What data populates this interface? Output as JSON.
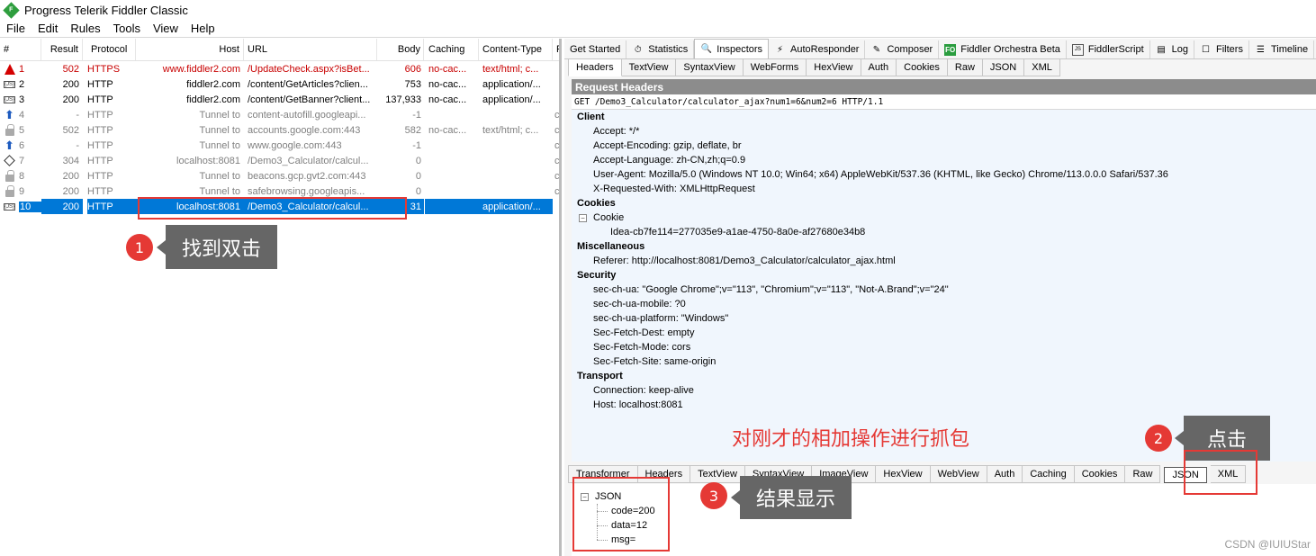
{
  "app": {
    "title": "Progress Telerik Fiddler Classic",
    "icon_letter": "F"
  },
  "menu": [
    "File",
    "Edit",
    "Rules",
    "Tools",
    "View",
    "Help"
  ],
  "sessions": {
    "columns": {
      "num": "#",
      "result": "Result",
      "protocol": "Protocol",
      "host": "Host",
      "url": "URL",
      "body": "Body",
      "caching": "Caching",
      "content_type": "Content-Type",
      "p": "P"
    },
    "rows": [
      {
        "icon": "warning-icon",
        "num": "1",
        "result": "502",
        "protocol": "HTTPS",
        "host": "www.fiddler2.com",
        "url": "/UpdateCheck.aspx?isBet...",
        "body": "606",
        "caching": "no-cac...",
        "content_type": "text/html; c...",
        "p": "",
        "style": "red"
      },
      {
        "icon": "json-icon",
        "num": "2",
        "result": "200",
        "protocol": "HTTP",
        "host": "fiddler2.com",
        "url": "/content/GetArticles?clien...",
        "body": "753",
        "caching": "no-cac...",
        "content_type": "application/...",
        "p": "",
        "style": "normal"
      },
      {
        "icon": "json-icon",
        "num": "3",
        "result": "200",
        "protocol": "HTTP",
        "host": "fiddler2.com",
        "url": "/content/GetBanner?client...",
        "body": "137,933",
        "caching": "no-cac...",
        "content_type": "application/...",
        "p": "",
        "style": "normal"
      },
      {
        "icon": "upload-arrow-icon",
        "num": "4",
        "result": "-",
        "protocol": "HTTP",
        "host": "Tunnel to",
        "url": "content-autofill.googleapi...",
        "body": "-1",
        "caching": "",
        "content_type": "",
        "p": "c",
        "style": "gray"
      },
      {
        "icon": "lock-icon",
        "num": "5",
        "result": "502",
        "protocol": "HTTP",
        "host": "Tunnel to",
        "url": "accounts.google.com:443",
        "body": "582",
        "caching": "no-cac...",
        "content_type": "text/html; c...",
        "p": "c",
        "style": "gray"
      },
      {
        "icon": "upload-arrow-icon",
        "num": "6",
        "result": "-",
        "protocol": "HTTP",
        "host": "Tunnel to",
        "url": "www.google.com:443",
        "body": "-1",
        "caching": "",
        "content_type": "",
        "p": "c",
        "style": "gray"
      },
      {
        "icon": "diamond-icon",
        "num": "7",
        "result": "304",
        "protocol": "HTTP",
        "host": "localhost:8081",
        "url": "/Demo3_Calculator/calcul...",
        "body": "0",
        "caching": "",
        "content_type": "",
        "p": "c",
        "style": "gray"
      },
      {
        "icon": "lock-icon",
        "num": "8",
        "result": "200",
        "protocol": "HTTP",
        "host": "Tunnel to",
        "url": "beacons.gcp.gvt2.com:443",
        "body": "0",
        "caching": "",
        "content_type": "",
        "p": "c",
        "style": "gray"
      },
      {
        "icon": "lock-icon",
        "num": "9",
        "result": "200",
        "protocol": "HTTP",
        "host": "Tunnel to",
        "url": "safebrowsing.googleapis...",
        "body": "0",
        "caching": "",
        "content_type": "",
        "p": "c",
        "style": "gray"
      },
      {
        "icon": "json-icon",
        "num": "10",
        "result": "200",
        "protocol": "HTTP",
        "host": "localhost:8081",
        "url": "/Demo3_Calculator/calcul...",
        "body": "31",
        "caching": "",
        "content_type": "application/...",
        "p": "",
        "style": "selected"
      }
    ]
  },
  "annotations": {
    "one": {
      "num": "1",
      "text": "找到双击"
    },
    "two": {
      "num": "2",
      "text": "点击"
    },
    "three": {
      "num": "3",
      "text": "结果显示"
    },
    "middle": "对刚才的相加操作进行抓包"
  },
  "inspector_tabs": [
    {
      "label": "Get Started",
      "icon": "",
      "active": false
    },
    {
      "label": "Statistics",
      "icon": "stopwatch-icon",
      "active": false
    },
    {
      "label": "Inspectors",
      "icon": "magnifier-icon",
      "active": true
    },
    {
      "label": "AutoResponder",
      "icon": "lightning-icon",
      "active": false
    },
    {
      "label": "Composer",
      "icon": "pencil-icon",
      "active": false
    },
    {
      "label": "Fiddler Orchestra Beta",
      "icon": "fo-icon",
      "active": false
    },
    {
      "label": "FiddlerScript",
      "icon": "script-icon",
      "active": false
    },
    {
      "label": "Log",
      "icon": "log-icon",
      "active": false
    },
    {
      "label": "Filters",
      "icon": "checkbox-icon",
      "active": false
    },
    {
      "label": "Timeline",
      "icon": "timeline-icon",
      "active": false
    }
  ],
  "request_tabs": [
    "Headers",
    "TextView",
    "SyntaxView",
    "WebForms",
    "HexView",
    "Auth",
    "Cookies",
    "Raw",
    "JSON",
    "XML"
  ],
  "request_headers": {
    "title": "Request Headers",
    "request_line": "GET /Demo3_Calculator/calculator_ajax?num1=6&num2=6 HTTP/1.1",
    "client_label": "Client",
    "client": [
      "Accept: */*",
      "Accept-Encoding: gzip, deflate, br",
      "Accept-Language: zh-CN,zh;q=0.9",
      "User-Agent: Mozilla/5.0 (Windows NT 10.0; Win64; x64) AppleWebKit/537.36 (KHTML, like Gecko) Chrome/113.0.0.0 Safari/537.36",
      "X-Requested-With: XMLHttpRequest"
    ],
    "cookies_label": "Cookies",
    "cookie_node": "Cookie",
    "cookie_value": "Idea-cb7fe114=277035e9-a1ae-4750-8a0e-af27680e34b8",
    "misc_label": "Miscellaneous",
    "misc": [
      "Referer: http://localhost:8081/Demo3_Calculator/calculator_ajax.html"
    ],
    "security_label": "Security",
    "security": [
      "sec-ch-ua: \"Google Chrome\";v=\"113\", \"Chromium\";v=\"113\", \"Not-A.Brand\";v=\"24\"",
      "sec-ch-ua-mobile: ?0",
      "sec-ch-ua-platform: \"Windows\"",
      "Sec-Fetch-Dest: empty",
      "Sec-Fetch-Mode: cors",
      "Sec-Fetch-Site: same-origin"
    ],
    "transport_label": "Transport",
    "transport": [
      "Connection: keep-alive",
      "Host: localhost:8081"
    ]
  },
  "response_tabs": [
    "Transformer",
    "Headers",
    "TextView",
    "SyntaxView",
    "ImageView",
    "HexView",
    "WebView",
    "Auth",
    "Caching",
    "Cookies",
    "Raw",
    "JSON",
    "XML"
  ],
  "response_json": {
    "root": "JSON",
    "items": [
      "code=200",
      "data=12",
      "msg="
    ]
  },
  "watermark": "CSDN @IUIUStar"
}
